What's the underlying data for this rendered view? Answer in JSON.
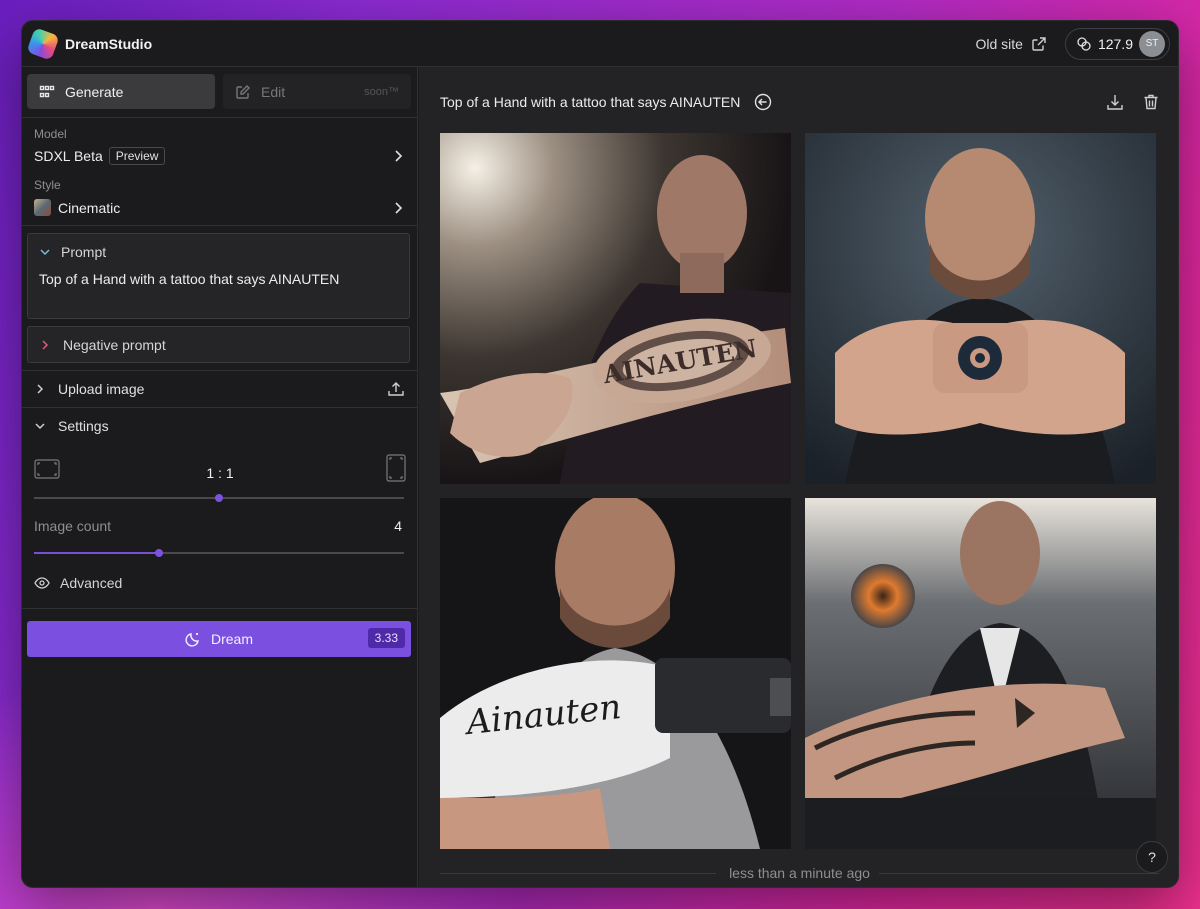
{
  "app": {
    "name": "DreamStudio"
  },
  "header": {
    "old_site_label": "Old site",
    "credits": "127.9",
    "avatar_initials": "ST"
  },
  "tabs": [
    {
      "label": "Generate",
      "icon": "grid-icon",
      "active": true
    },
    {
      "label": "Edit",
      "icon": "edit-icon",
      "active": false,
      "badge": "soon™"
    }
  ],
  "model": {
    "label": "Model",
    "value": "SDXL Beta",
    "badge": "Preview"
  },
  "style": {
    "label": "Style",
    "value": "Cinematic"
  },
  "prompt": {
    "label": "Prompt",
    "value": "Top of a Hand with a tattoo that says AINAUTEN"
  },
  "negative_prompt": {
    "label": "Negative prompt"
  },
  "upload_image": {
    "label": "Upload image"
  },
  "settings": {
    "label": "Settings",
    "aspect_ratio": "1 : 1",
    "image_count_label": "Image count",
    "image_count": "4",
    "advanced_label": "Advanced"
  },
  "dream": {
    "label": "Dream",
    "cost": "3.33"
  },
  "main": {
    "title": "Top of a Hand with a tattoo that says AINAUTEN",
    "footer_time": "less than a minute ago",
    "help_label": "?"
  },
  "images": [
    {
      "tattoo_text": "AINAUTEN"
    },
    {
      "tattoo_text": ""
    },
    {
      "tattoo_text": "Ainauten"
    },
    {
      "tattoo_text": ""
    }
  ],
  "colors": {
    "accent": "#7b4fe0",
    "background": "#1b1b1d",
    "panel": "#232325"
  }
}
